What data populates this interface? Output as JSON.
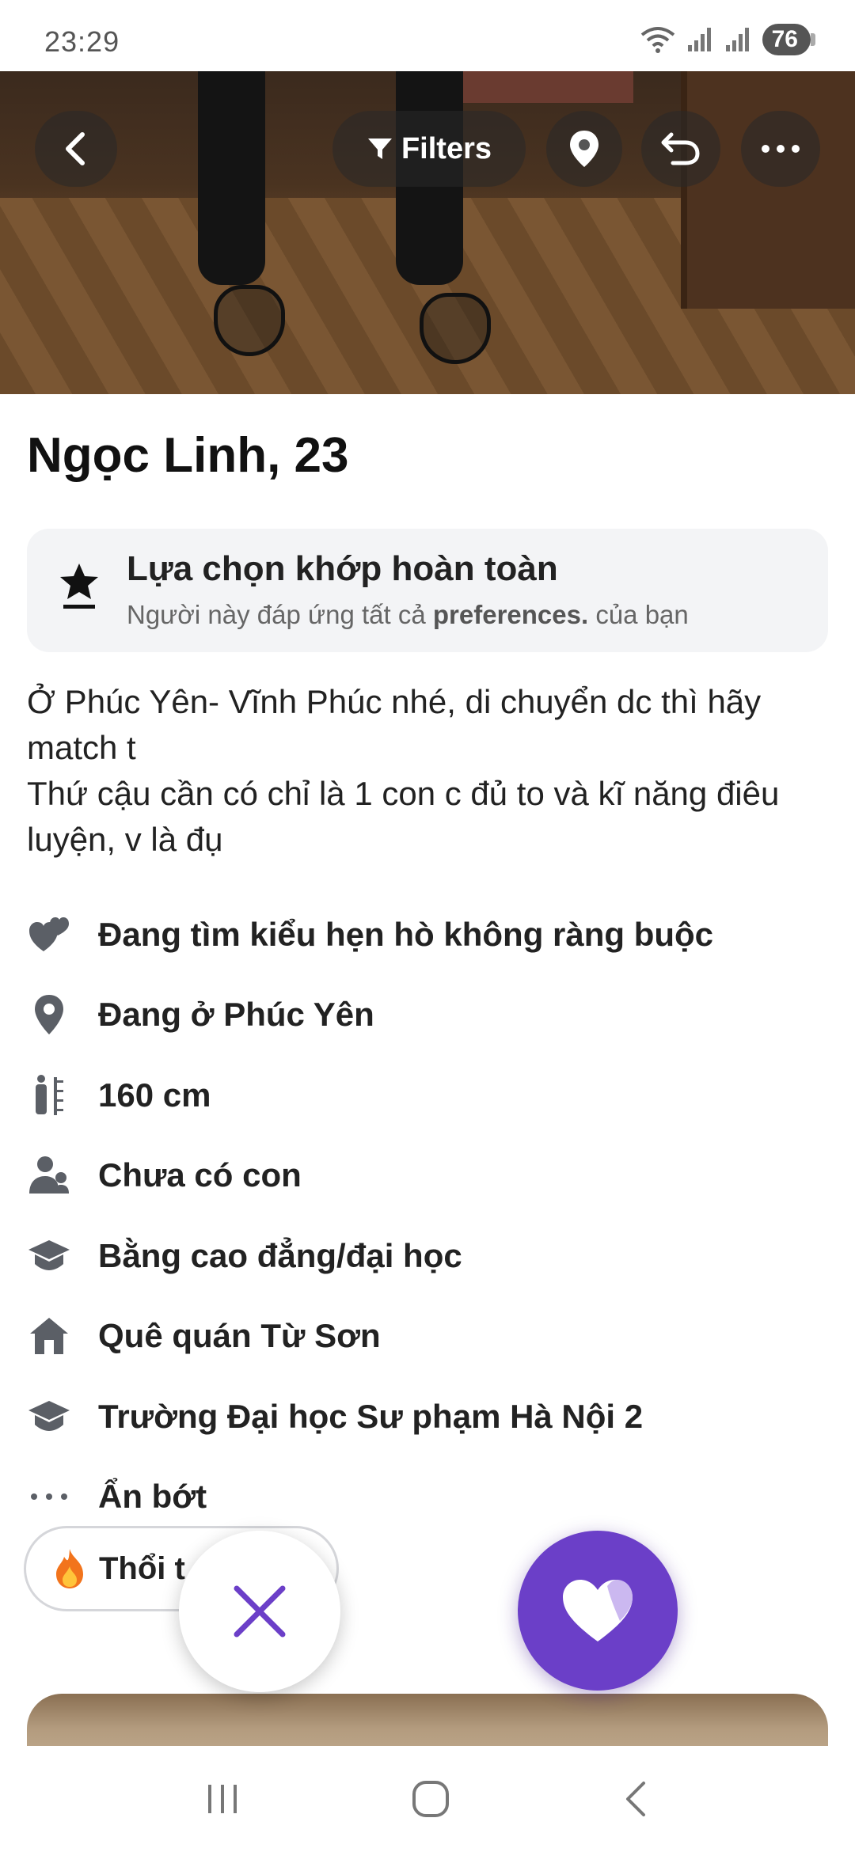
{
  "status_bar": {
    "time": "23:29",
    "battery": "76"
  },
  "top_controls": {
    "filters_label": "Filters"
  },
  "profile": {
    "name": "Ngọc Linh, 23"
  },
  "match_card": {
    "title": "Lựa chọn khớp hoàn toàn",
    "subtitle_before": "Người này đáp ứng tất cả ",
    "subtitle_bold": "preferences.",
    "subtitle_after": " của bạn"
  },
  "bio": {
    "line1": "Ở Phúc Yên- Vĩnh Phúc nhé, di chuyển dc thì hãy match t",
    "line2": "Thứ cậu cần có chỉ là 1 con c đủ to và kĩ năng điêu luyện, v là đụ"
  },
  "info": [
    {
      "icon": "hearts-icon",
      "text": "Đang tìm kiểu hẹn hò không ràng buộc"
    },
    {
      "icon": "location-pin-icon",
      "text": "Đang ở Phúc Yên"
    },
    {
      "icon": "height-icon",
      "text": "160 cm"
    },
    {
      "icon": "children-icon",
      "text": "Chưa có con"
    },
    {
      "icon": "graduation-cap-icon",
      "text": "Bằng cao đẳng/đại học"
    },
    {
      "icon": "home-icon",
      "text": "Quê quán Từ Sơn"
    },
    {
      "icon": "graduation-cap-icon",
      "text": "Trường Đại học Sư phạm Hà Nội 2"
    },
    {
      "icon": "more-dots-icon",
      "text": "Ẩn bớt"
    }
  ],
  "chip": {
    "label": "Thổi t",
    "icon": "fire-icon"
  },
  "colors": {
    "accent": "#6b3fc8",
    "card_bg": "#f3f4f6"
  }
}
